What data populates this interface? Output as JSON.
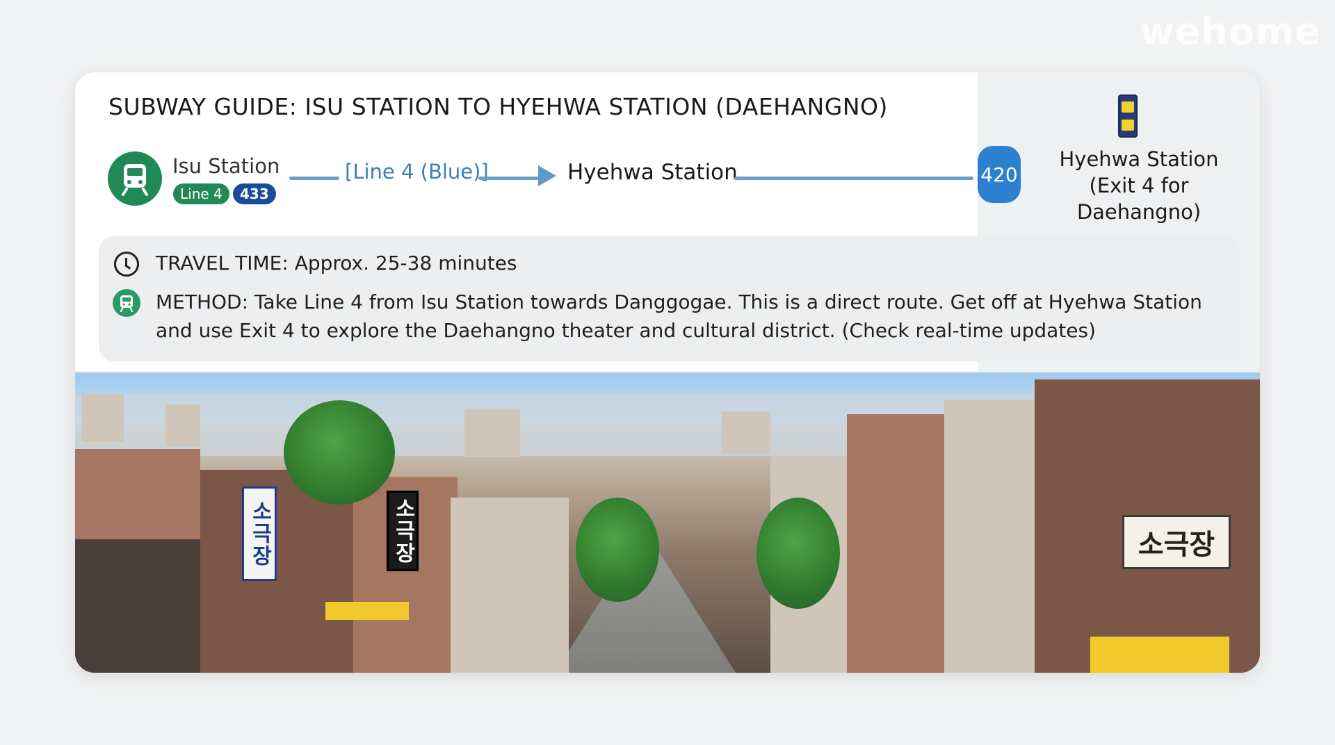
{
  "watermark": "wehome",
  "guide": {
    "title": "SUBWAY GUIDE: ISU STATION TO HYEHWA STATION (DAEHANGNO)",
    "origin": {
      "name": "Isu Station",
      "line_pill": "Line 4",
      "station_number": "433",
      "icon": "subway-train-icon"
    },
    "route_label": "[Line 4 (Blue)]",
    "destination": "Hyehwa Station",
    "destination_badge": "420",
    "exit": {
      "line1": "Hyehwa Station",
      "line2": "(Exit 4 for Daehangno)",
      "icon": "station-sign-icon"
    },
    "travel_time_label": "TRAVEL TIME:",
    "travel_time_value": "Approx. 25-38 minutes",
    "method_label": "METHOD:",
    "method_text": "Take Line 4 from Isu Station towards Danggogae. This is a direct route. Get off at Hyehwa Station and use Exit 4 to explore the Daehangno theater and cultural district.",
    "method_note": "(Check real-time updates)"
  },
  "photo": {
    "signs": [
      "소극장",
      "소극장",
      "소극장"
    ]
  },
  "colors": {
    "line4_green": "#1f8a55",
    "line4_blue": "#6b9ec8",
    "badge_blue": "#2d7fd0",
    "station_num_navy": "#1a4b96"
  }
}
